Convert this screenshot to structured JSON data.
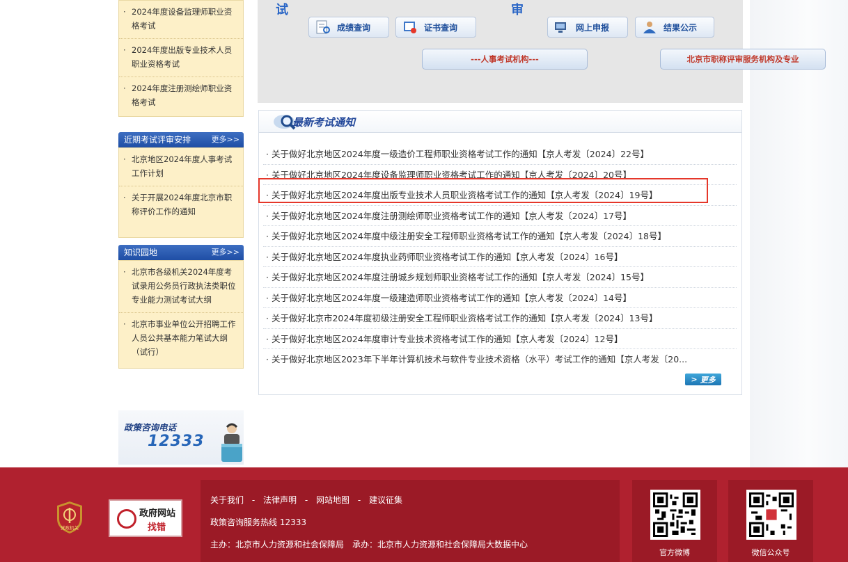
{
  "left": {
    "exam_list": [
      {
        "label": "2024年度设备监理师职业资格考试"
      },
      {
        "label": "2024年度出版专业技术人员职业资格考试"
      },
      {
        "label": "2024年度注册测绘师职业资格考试"
      }
    ],
    "schedule": {
      "title": "近期考试评审安排",
      "more": "更多>>",
      "items": [
        {
          "label": "北京地区2024年度人事考试工作计划"
        },
        {
          "label": "关于开展2024年度北京市职称评价工作的通知"
        }
      ]
    },
    "knowledge": {
      "title": "知识园地",
      "more": "更多>>",
      "items": [
        {
          "label": "北京市各级机关2024年度考试录用公务员行政执法类职位专业能力测试考试大纲"
        },
        {
          "label": "北京市事业单位公开招聘工作人员公共基本能力笔试大纲（试行）"
        }
      ]
    },
    "hotline": {
      "title": "政策咨询电话",
      "number": "12333"
    }
  },
  "top_panel": {
    "exam_section": "试",
    "review_section": "审",
    "buttons": {
      "score": "成绩查询",
      "cert": "证书查询",
      "online": "网上申报",
      "result": "结果公示"
    },
    "exam_org": "---人事考试机构---",
    "review_org": "北京市职称评审服务机构及专业"
  },
  "news": {
    "title": "最新考试通知",
    "items": [
      "关于做好北京地区2024年度一级造价工程师职业资格考试工作的通知【京人考发〔2024〕22号】",
      "关于做好北京地区2024年度设备监理师职业资格考试工作的通知【京人考发〔2024〕20号】",
      "关于做好北京地区2024年度出版专业技术人员职业资格考试工作的通知【京人考发〔2024〕19号】",
      "关于做好北京地区2024年度注册测绘师职业资格考试工作的通知【京人考发〔2024〕17号】",
      "关于做好北京地区2024年度中级注册安全工程师职业资格考试工作的通知【京人考发〔2024〕18号】",
      "关于做好北京地区2024年度执业药师职业资格考试工作的通知【京人考发〔2024〕16号】",
      "关于做好北京地区2024年度注册城乡规划师职业资格考试工作的通知【京人考发〔2024〕15号】",
      "关于做好北京地区2024年度一级建造师职业资格考试工作的通知【京人考发〔2024〕14号】",
      "关于做好北京市2024年度初级注册安全工程师职业资格考试工作的通知【京人考发〔2024〕13号】",
      "关于做好北京地区2024年度审计专业技术资格考试工作的通知【京人考发〔2024〕12号】",
      "关于做好北京地区2023年下半年计算机技术与软件专业技术资格（水平）考试工作的通知【京人考发〔20..."
    ],
    "more": "更多"
  },
  "footer": {
    "links": [
      "关于我们",
      "法律声明",
      "网站地图",
      "建议征集"
    ],
    "separator": "-",
    "hotline": "政策咨询服务热线 12333",
    "sponsor": "主办：北京市人力资源和社会保障局　承办：北京市人力资源和社会保障局大数据中心",
    "finder_line1": "政府网站",
    "finder_line2": "找错",
    "emblem_text": "党政机关",
    "weibo": "官方微博",
    "wechat": "微信公众号"
  },
  "colors": {
    "footer": "#b0212f",
    "highlight": "#e5372a",
    "accent": "#2a66c6"
  }
}
